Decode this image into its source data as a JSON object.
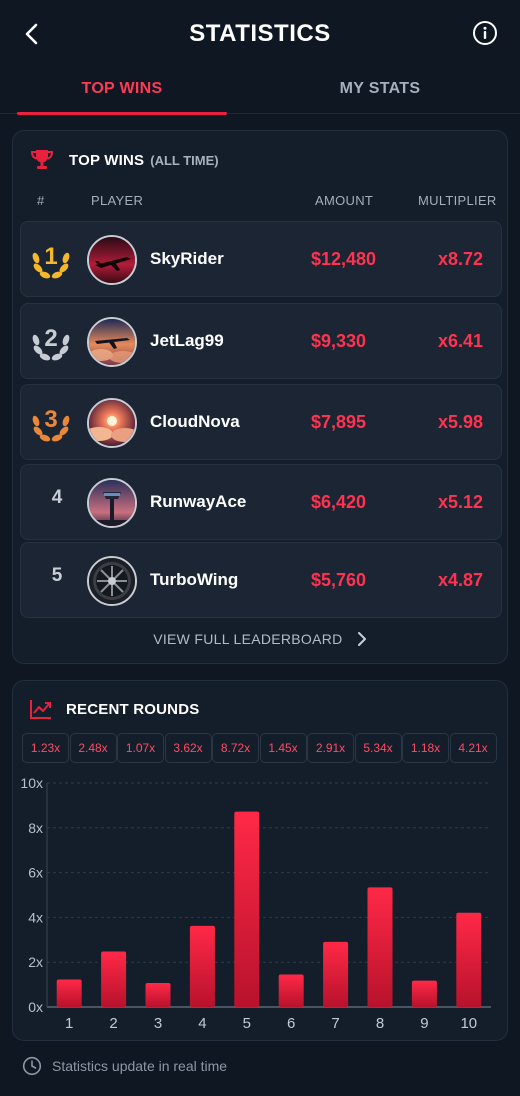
{
  "header": {
    "title": "STATISTICS"
  },
  "tabs": [
    {
      "label": "TOP WINS",
      "active": true
    },
    {
      "label": "MY STATS",
      "active": false
    }
  ],
  "top_wins": {
    "title": "TOP WINS",
    "subtitle": "(ALL TIME)",
    "columns": {
      "rank": "#",
      "player": "PLAYER",
      "amount": "AMOUNT",
      "multiplier": "MULTIPLIER"
    },
    "rows": [
      {
        "rank": "1",
        "player": "SkyRider",
        "amount": "$12,480",
        "multiplier": "x8.72",
        "medal": "gold",
        "avatar": "plane-sunset"
      },
      {
        "rank": "2",
        "player": "JetLag99",
        "amount": "$9,330",
        "multiplier": "x6.41",
        "medal": "silver",
        "avatar": "plane-clouds"
      },
      {
        "rank": "3",
        "player": "CloudNova",
        "amount": "$7,895",
        "multiplier": "x5.98",
        "medal": "bronze",
        "avatar": "sun-clouds"
      },
      {
        "rank": "4",
        "player": "RunwayAce",
        "amount": "$6,420",
        "multiplier": "x5.12",
        "medal": null,
        "avatar": "control-tower"
      },
      {
        "rank": "5",
        "player": "TurboWing",
        "amount": "$5,760",
        "multiplier": "x4.87",
        "medal": null,
        "avatar": "jet-engine"
      }
    ],
    "view_full": "VIEW FULL LEADERBOARD"
  },
  "recent": {
    "title": "RECENT ROUNDS",
    "chips": [
      "1.23x",
      "2.48x",
      "1.07x",
      "3.62x",
      "8.72x",
      "1.45x",
      "2.91x",
      "5.34x",
      "1.18x",
      "4.21x"
    ]
  },
  "chart_data": {
    "type": "bar",
    "categories": [
      "1",
      "2",
      "3",
      "4",
      "5",
      "6",
      "7",
      "8",
      "9",
      "10"
    ],
    "values": [
      1.23,
      2.48,
      1.07,
      3.62,
      8.72,
      1.45,
      2.91,
      5.34,
      1.18,
      4.21
    ],
    "yticks": [
      "0x",
      "2x",
      "4x",
      "6x",
      "8x",
      "10x"
    ],
    "ylim": [
      0,
      10
    ],
    "grid": true,
    "bar_color": "#e8213f"
  },
  "footer": {
    "text": "Statistics update in real time"
  },
  "colors": {
    "accent": "#ff3350",
    "background": "#0f1723",
    "card": "#141e2b",
    "gold": "#f4b82a",
    "silver": "#c7ccd3",
    "bronze": "#e88838"
  }
}
